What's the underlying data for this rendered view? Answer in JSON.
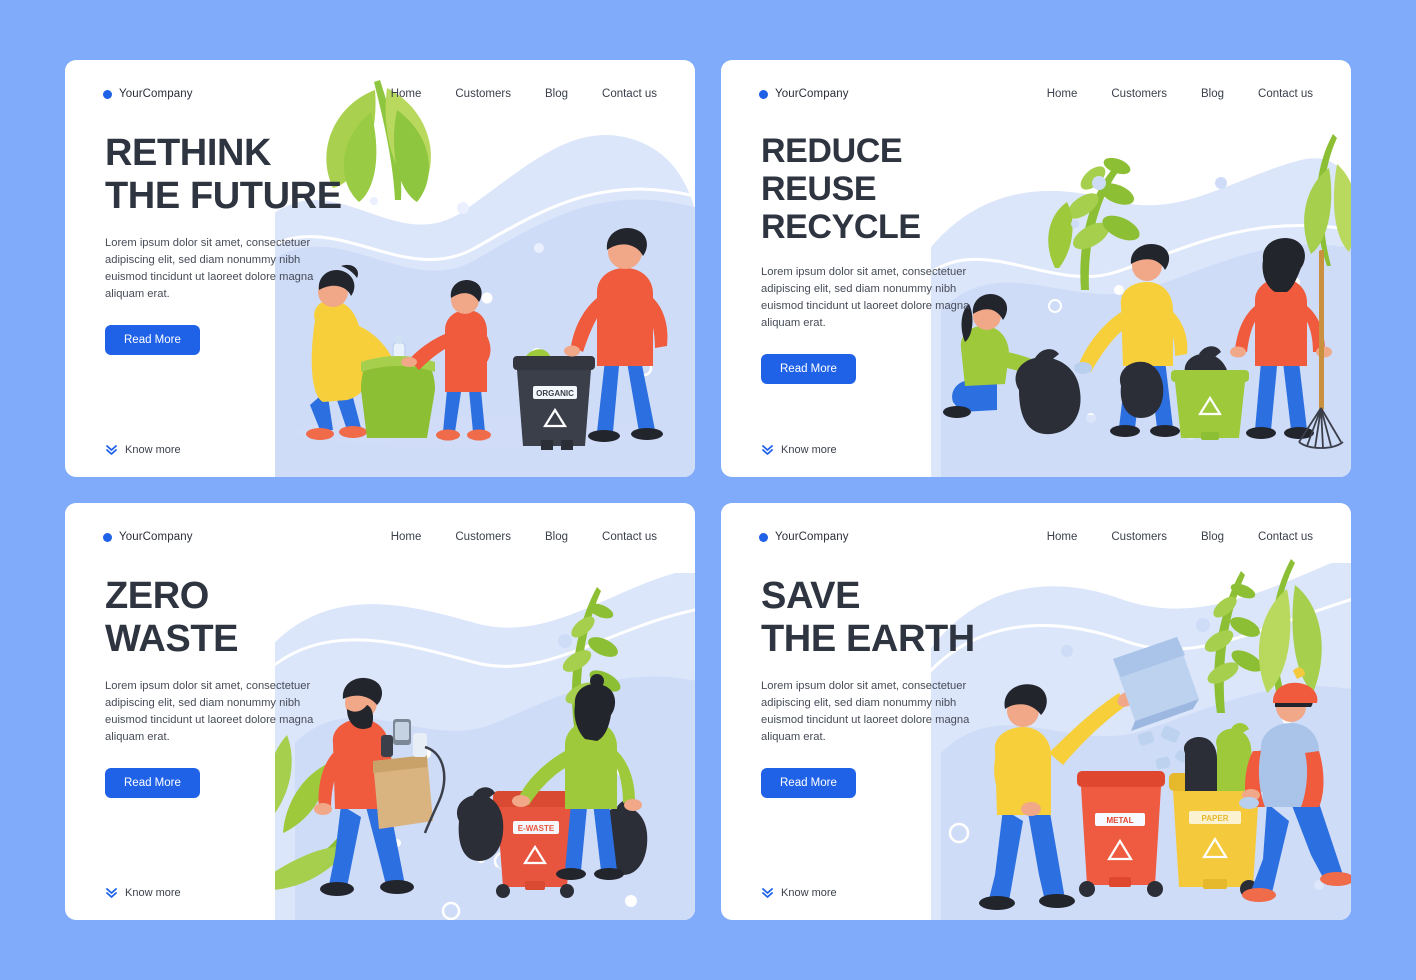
{
  "page": {
    "background_color": "#80abfa",
    "card_background": "#ffffff",
    "accent_color": "#1f62e8",
    "heading_color": "#2e3440",
    "illustration_blob_color": "#dce6fa"
  },
  "nav": {
    "brand": "YourCompany",
    "brand_dot_icon": "blue-dot-icon",
    "links": [
      "Home",
      "Customers",
      "Blog",
      "Contact us"
    ]
  },
  "common": {
    "lede": "Lorem ipsum dolor sit amet, consectetuer adipiscing elit, sed diam nonummy nibh euismod tincidunt ut laoreet dolore magna aliquam erat.",
    "cta_label": "Read More",
    "know_more_label": "Know more",
    "know_more_icon": "double-chevron-down-icon"
  },
  "cards": [
    {
      "id": "rethink-the-future",
      "headline_lines": [
        "RETHINK",
        "THE FUTURE"
      ],
      "illustration": {
        "name": "family-sorting-waste-illustration",
        "bin_labels": [
          "ORGANIC"
        ],
        "bin_colors": [
          "#3b3f4a"
        ],
        "figures": [
          "woman-yellow-sweater",
          "boy-orange-shirt",
          "man-red-sweater"
        ],
        "props": [
          "green-garbage-bag",
          "plastic-bottle",
          "banana-leaf-plant",
          "recycle-symbol"
        ]
      }
    },
    {
      "id": "reduce-reuse-recycle",
      "headline_lines": [
        "REDUCE",
        "REUSE",
        "RECYCLE"
      ],
      "illustration": {
        "name": "volunteers-collecting-trash-illustration",
        "bin_labels": [],
        "bin_colors": [
          "#9ec93a"
        ],
        "figures": [
          "kneeling-woman-green-top",
          "man-yellow-jacket",
          "woman-red-top-with-rake"
        ],
        "props": [
          "black-garbage-bags",
          "green-recycle-bin",
          "rake",
          "leaf-plants",
          "recycle-symbol"
        ]
      }
    },
    {
      "id": "zero-waste",
      "headline_lines": [
        "ZERO",
        "WASTE"
      ],
      "illustration": {
        "name": "ewaste-recycling-illustration",
        "bin_labels": [
          "E-WASTE"
        ],
        "bin_colors": [
          "#e8553f"
        ],
        "figures": [
          "bearded-man-orange-sweater",
          "woman-green-jacket"
        ],
        "props": [
          "cardboard-box-with-electronics",
          "black-garbage-bags",
          "red-ewaste-bin",
          "leaf-plants",
          "recycle-symbol"
        ]
      }
    },
    {
      "id": "save-the-earth",
      "headline_lines": [
        "SAVE",
        "THE EARTH"
      ],
      "illustration": {
        "name": "sorting-metal-and-paper-illustration",
        "bin_labels": [
          "METAL",
          "PAPER"
        ],
        "bin_colors": [
          "#ef5b41",
          "#f4c93c"
        ],
        "figures": [
          "man-yellow-sweater-throwing-box",
          "worker-orange-vest"
        ],
        "props": [
          "blue-cardboard-box",
          "red-metal-bin",
          "yellow-paper-bin",
          "garbage-bags",
          "leaf-plants",
          "recycle-symbol"
        ]
      }
    }
  ]
}
